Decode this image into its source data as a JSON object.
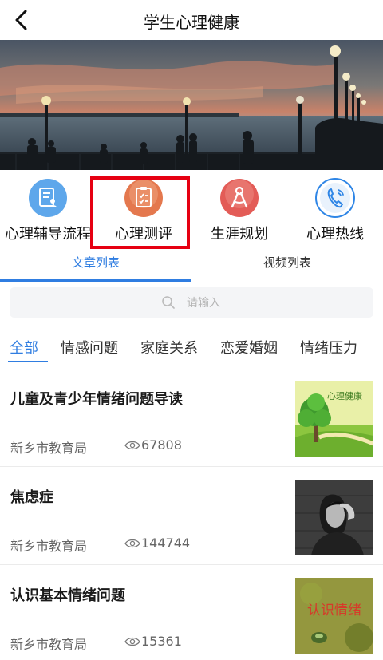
{
  "header": {
    "title": "学生心理健康",
    "back_icon": "chevron-left-icon"
  },
  "menu": [
    {
      "label": "心理辅导流程",
      "icon": "clipboard-person-icon",
      "color": "#3e96e6"
    },
    {
      "label": "心理测评",
      "icon": "checklist-icon",
      "color": "#e4784e"
    },
    {
      "label": "生涯规划",
      "icon": "compass-icon",
      "color": "#e35c57"
    },
    {
      "label": "心理热线",
      "icon": "phone-icon",
      "color": "#2f86e6"
    }
  ],
  "tabs": [
    {
      "label": "文章列表",
      "active": true
    },
    {
      "label": "视频列表",
      "active": false
    }
  ],
  "search": {
    "placeholder": "请输入"
  },
  "categories": [
    "全部",
    "情感问题",
    "家庭关系",
    "恋爱婚姻",
    "情绪压力"
  ],
  "active_category": "全部",
  "articles": [
    {
      "title": "儿童及青少年情绪问题导读",
      "source": "新乡市教育局",
      "views": "67808",
      "thumb_text": "心理健康"
    },
    {
      "title": "焦虑症",
      "source": "新乡市教育局",
      "views": "144744"
    },
    {
      "title": "认识基本情绪问题",
      "source": "新乡市教育局",
      "views": "15361",
      "thumb_text": "认识情绪"
    }
  ],
  "colors": {
    "accent": "#2f7de1",
    "highlight": "#e60012"
  }
}
